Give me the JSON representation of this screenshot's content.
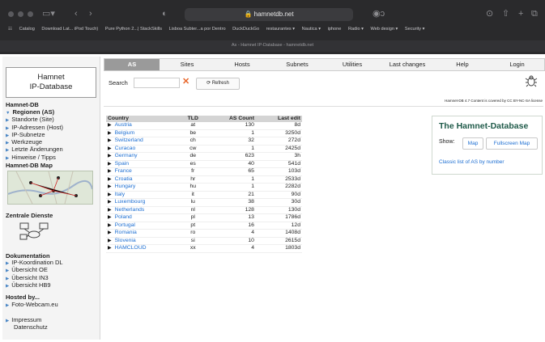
{
  "browser": {
    "url": "hamnetdb.net",
    "bookmarks": [
      "Catalog",
      "Download Lat... iPod Touch)",
      "Pure Python 2...| StackSkills",
      "Lisboa Subter...a por Dentro",
      "DuckDuckGo",
      "restaurantes ▾",
      "Nautica ▾",
      "iphone",
      "Radio ▾",
      "Web design ▾",
      "Security ▾"
    ],
    "tab_title": "As - Hamnet IP-Database - hamnetdb.net"
  },
  "logo": {
    "line1": "Hamnet",
    "line2": "IP-Database"
  },
  "sidebar": {
    "hamnet_db_heading": "Hamnet-DB",
    "hamnet_db_items": [
      "Regionen (AS)",
      "Standorte (Site)",
      "IP-Adressen (Host)",
      "IP-Subnetze",
      "Werkzeuge",
      "Letzte Änderungen",
      "Hinweise / Tipps"
    ],
    "map_heading": "Hamnet-DB Map",
    "services_heading": "Zentrale Dienste",
    "doc_heading": "Dokumentation",
    "doc_items": [
      "IP-Koordination DL",
      "Übersicht OE",
      "Übersicht IN3",
      "Übersicht HB9"
    ],
    "hosted_heading": "Hosted by...",
    "hosted_items": [
      "Foto-Webcam.eu"
    ],
    "footer_items": [
      "Impressum",
      "Datenschutz"
    ]
  },
  "nav": [
    "AS",
    "Sites",
    "Hosts",
    "Subnets",
    "Utilities",
    "Last changes",
    "Help",
    "Login"
  ],
  "search": {
    "label": "Search",
    "refresh_label": "Refresh"
  },
  "license": "Hamnet-DB 4.7 Content is covered by CC BY-NC-SA license",
  "table": {
    "headers": [
      "Country",
      "TLD",
      "AS Count",
      "Last edit"
    ],
    "rows": [
      [
        "Austria",
        "at",
        "130",
        "8d"
      ],
      [
        "Belgium",
        "be",
        "1",
        "3250d"
      ],
      [
        "Switzerland",
        "ch",
        "32",
        "272d"
      ],
      [
        "Curacao",
        "cw",
        "1",
        "2425d"
      ],
      [
        "Germany",
        "de",
        "623",
        "3h"
      ],
      [
        "Spain",
        "es",
        "40",
        "541d"
      ],
      [
        "France",
        "fr",
        "65",
        "103d"
      ],
      [
        "Croatia",
        "hr",
        "1",
        "2533d"
      ],
      [
        "Hungary",
        "hu",
        "1",
        "2282d"
      ],
      [
        "Italy",
        "it",
        "21",
        "90d"
      ],
      [
        "Luxembourg",
        "lu",
        "38",
        "30d"
      ],
      [
        "Netherlands",
        "nl",
        "128",
        "130d"
      ],
      [
        "Poland",
        "pl",
        "13",
        "1786d"
      ],
      [
        "Portugal",
        "pt",
        "16",
        "12d"
      ],
      [
        "Romania",
        "ro",
        "4",
        "1408d"
      ],
      [
        "Slovenia",
        "si",
        "10",
        "2615d"
      ],
      [
        "HAMCLOUD",
        "xx",
        "4",
        "1803d"
      ]
    ]
  },
  "infobox": {
    "title": "The Hamnet-Database",
    "show_label": "Show:",
    "map_button": "Map",
    "fullscreen_button": "Fullscreen Map",
    "classic_link": "Classic list of AS by number"
  },
  "colors": {
    "link": "#1c6ed2",
    "active_tab": "#9a9a9a",
    "info_title": "#1f5a49",
    "clear_x": "#e8662a"
  }
}
